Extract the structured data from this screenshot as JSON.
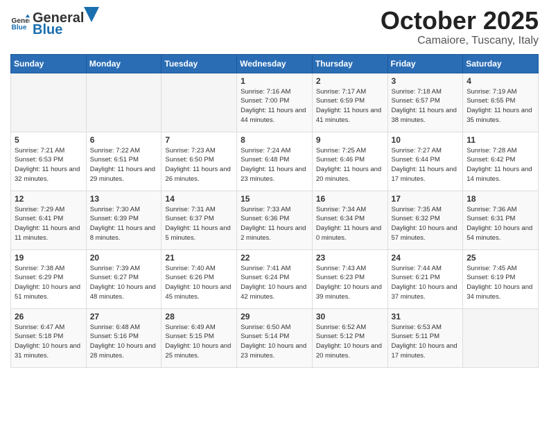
{
  "header": {
    "logo_general": "General",
    "logo_blue": "Blue",
    "month": "October 2025",
    "location": "Camaiore, Tuscany, Italy"
  },
  "days_of_week": [
    "Sunday",
    "Monday",
    "Tuesday",
    "Wednesday",
    "Thursday",
    "Friday",
    "Saturday"
  ],
  "weeks": [
    [
      {
        "day": "",
        "info": ""
      },
      {
        "day": "",
        "info": ""
      },
      {
        "day": "",
        "info": ""
      },
      {
        "day": "1",
        "info": "Sunrise: 7:16 AM\nSunset: 7:00 PM\nDaylight: 11 hours and 44 minutes."
      },
      {
        "day": "2",
        "info": "Sunrise: 7:17 AM\nSunset: 6:59 PM\nDaylight: 11 hours and 41 minutes."
      },
      {
        "day": "3",
        "info": "Sunrise: 7:18 AM\nSunset: 6:57 PM\nDaylight: 11 hours and 38 minutes."
      },
      {
        "day": "4",
        "info": "Sunrise: 7:19 AM\nSunset: 6:55 PM\nDaylight: 11 hours and 35 minutes."
      }
    ],
    [
      {
        "day": "5",
        "info": "Sunrise: 7:21 AM\nSunset: 6:53 PM\nDaylight: 11 hours and 32 minutes."
      },
      {
        "day": "6",
        "info": "Sunrise: 7:22 AM\nSunset: 6:51 PM\nDaylight: 11 hours and 29 minutes."
      },
      {
        "day": "7",
        "info": "Sunrise: 7:23 AM\nSunset: 6:50 PM\nDaylight: 11 hours and 26 minutes."
      },
      {
        "day": "8",
        "info": "Sunrise: 7:24 AM\nSunset: 6:48 PM\nDaylight: 11 hours and 23 minutes."
      },
      {
        "day": "9",
        "info": "Sunrise: 7:25 AM\nSunset: 6:46 PM\nDaylight: 11 hours and 20 minutes."
      },
      {
        "day": "10",
        "info": "Sunrise: 7:27 AM\nSunset: 6:44 PM\nDaylight: 11 hours and 17 minutes."
      },
      {
        "day": "11",
        "info": "Sunrise: 7:28 AM\nSunset: 6:42 PM\nDaylight: 11 hours and 14 minutes."
      }
    ],
    [
      {
        "day": "12",
        "info": "Sunrise: 7:29 AM\nSunset: 6:41 PM\nDaylight: 11 hours and 11 minutes."
      },
      {
        "day": "13",
        "info": "Sunrise: 7:30 AM\nSunset: 6:39 PM\nDaylight: 11 hours and 8 minutes."
      },
      {
        "day": "14",
        "info": "Sunrise: 7:31 AM\nSunset: 6:37 PM\nDaylight: 11 hours and 5 minutes."
      },
      {
        "day": "15",
        "info": "Sunrise: 7:33 AM\nSunset: 6:36 PM\nDaylight: 11 hours and 2 minutes."
      },
      {
        "day": "16",
        "info": "Sunrise: 7:34 AM\nSunset: 6:34 PM\nDaylight: 11 hours and 0 minutes."
      },
      {
        "day": "17",
        "info": "Sunrise: 7:35 AM\nSunset: 6:32 PM\nDaylight: 10 hours and 57 minutes."
      },
      {
        "day": "18",
        "info": "Sunrise: 7:36 AM\nSunset: 6:31 PM\nDaylight: 10 hours and 54 minutes."
      }
    ],
    [
      {
        "day": "19",
        "info": "Sunrise: 7:38 AM\nSunset: 6:29 PM\nDaylight: 10 hours and 51 minutes."
      },
      {
        "day": "20",
        "info": "Sunrise: 7:39 AM\nSunset: 6:27 PM\nDaylight: 10 hours and 48 minutes."
      },
      {
        "day": "21",
        "info": "Sunrise: 7:40 AM\nSunset: 6:26 PM\nDaylight: 10 hours and 45 minutes."
      },
      {
        "day": "22",
        "info": "Sunrise: 7:41 AM\nSunset: 6:24 PM\nDaylight: 10 hours and 42 minutes."
      },
      {
        "day": "23",
        "info": "Sunrise: 7:43 AM\nSunset: 6:23 PM\nDaylight: 10 hours and 39 minutes."
      },
      {
        "day": "24",
        "info": "Sunrise: 7:44 AM\nSunset: 6:21 PM\nDaylight: 10 hours and 37 minutes."
      },
      {
        "day": "25",
        "info": "Sunrise: 7:45 AM\nSunset: 6:19 PM\nDaylight: 10 hours and 34 minutes."
      }
    ],
    [
      {
        "day": "26",
        "info": "Sunrise: 6:47 AM\nSunset: 5:18 PM\nDaylight: 10 hours and 31 minutes."
      },
      {
        "day": "27",
        "info": "Sunrise: 6:48 AM\nSunset: 5:16 PM\nDaylight: 10 hours and 28 minutes."
      },
      {
        "day": "28",
        "info": "Sunrise: 6:49 AM\nSunset: 5:15 PM\nDaylight: 10 hours and 25 minutes."
      },
      {
        "day": "29",
        "info": "Sunrise: 6:50 AM\nSunset: 5:14 PM\nDaylight: 10 hours and 23 minutes."
      },
      {
        "day": "30",
        "info": "Sunrise: 6:52 AM\nSunset: 5:12 PM\nDaylight: 10 hours and 20 minutes."
      },
      {
        "day": "31",
        "info": "Sunrise: 6:53 AM\nSunset: 5:11 PM\nDaylight: 10 hours and 17 minutes."
      },
      {
        "day": "",
        "info": ""
      }
    ]
  ]
}
